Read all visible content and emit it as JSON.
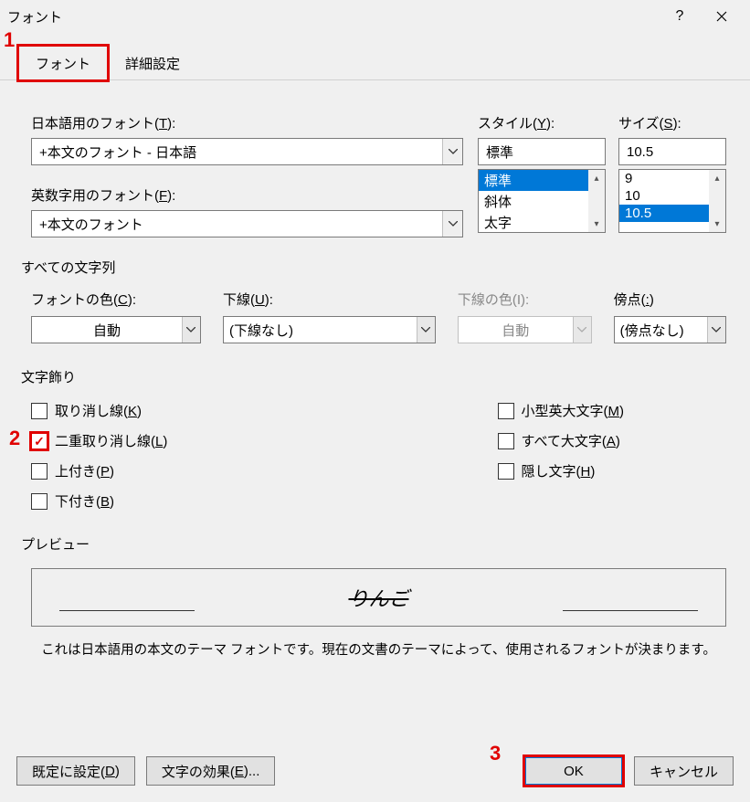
{
  "title": "フォント",
  "tabs": {
    "font": "フォント",
    "advanced": "詳細設定"
  },
  "labels": {
    "jpFont": "日本語用のフォント(T):",
    "jpFontAccess": "T",
    "latinFont": "英数字用のフォント(F):",
    "latinFontAccess": "F",
    "style": "スタイル(Y):",
    "styleAccess": "Y",
    "size": "サイズ(S):",
    "sizeAccess": "S",
    "allText": "すべての文字列",
    "fontColor": "フォントの色(C):",
    "fontColorAccess": "C",
    "underline": "下線(U):",
    "underlineAccess": "U",
    "underlineColor": "下線の色(I):",
    "underlineColorAccess": "I",
    "emphasis": "傍点(:)",
    "decoration": "文字飾り"
  },
  "values": {
    "jpFont": "+本文のフォント - 日本語",
    "latinFont": "+本文のフォント",
    "style": "標準",
    "size": "10.5",
    "fontColor": "自動",
    "underline": "(下線なし)",
    "underlineColor": "自動",
    "emphasis": "(傍点なし)"
  },
  "styleList": [
    "標準",
    "斜体",
    "太字"
  ],
  "styleSelectedIndex": 0,
  "sizeList": [
    "9",
    "10",
    "10.5"
  ],
  "sizeSelectedIndex": 2,
  "decorations": {
    "strike": "取り消し線(K)",
    "strikeAccess": "K",
    "doubleStrike": "二重取り消し線(L)",
    "doubleStrikeAccess": "L",
    "superscript": "上付き(P)",
    "superscriptAccess": "P",
    "subscript": "下付き(B)",
    "subscriptAccess": "B",
    "smallCaps": "小型英大文字(M)",
    "smallCapsAccess": "M",
    "allCaps": "すべて大文字(A)",
    "allCapsAccess": "A",
    "hidden": "隠し文字(H)",
    "hiddenAccess": "H"
  },
  "preview": {
    "label": "プレビュー",
    "text": "りんご",
    "desc": "これは日本語用の本文のテーマ フォントです。現在の文書のテーマによって、使用されるフォントが決まります。"
  },
  "buttons": {
    "setDefault": "既定に設定(D)",
    "setDefaultAccess": "D",
    "textEffects": "文字の効果(E)...",
    "textEffectsAccess": "E",
    "ok": "OK",
    "cancel": "キャンセル"
  },
  "annotations": {
    "m1": "1",
    "m2": "2",
    "m3": "3"
  }
}
